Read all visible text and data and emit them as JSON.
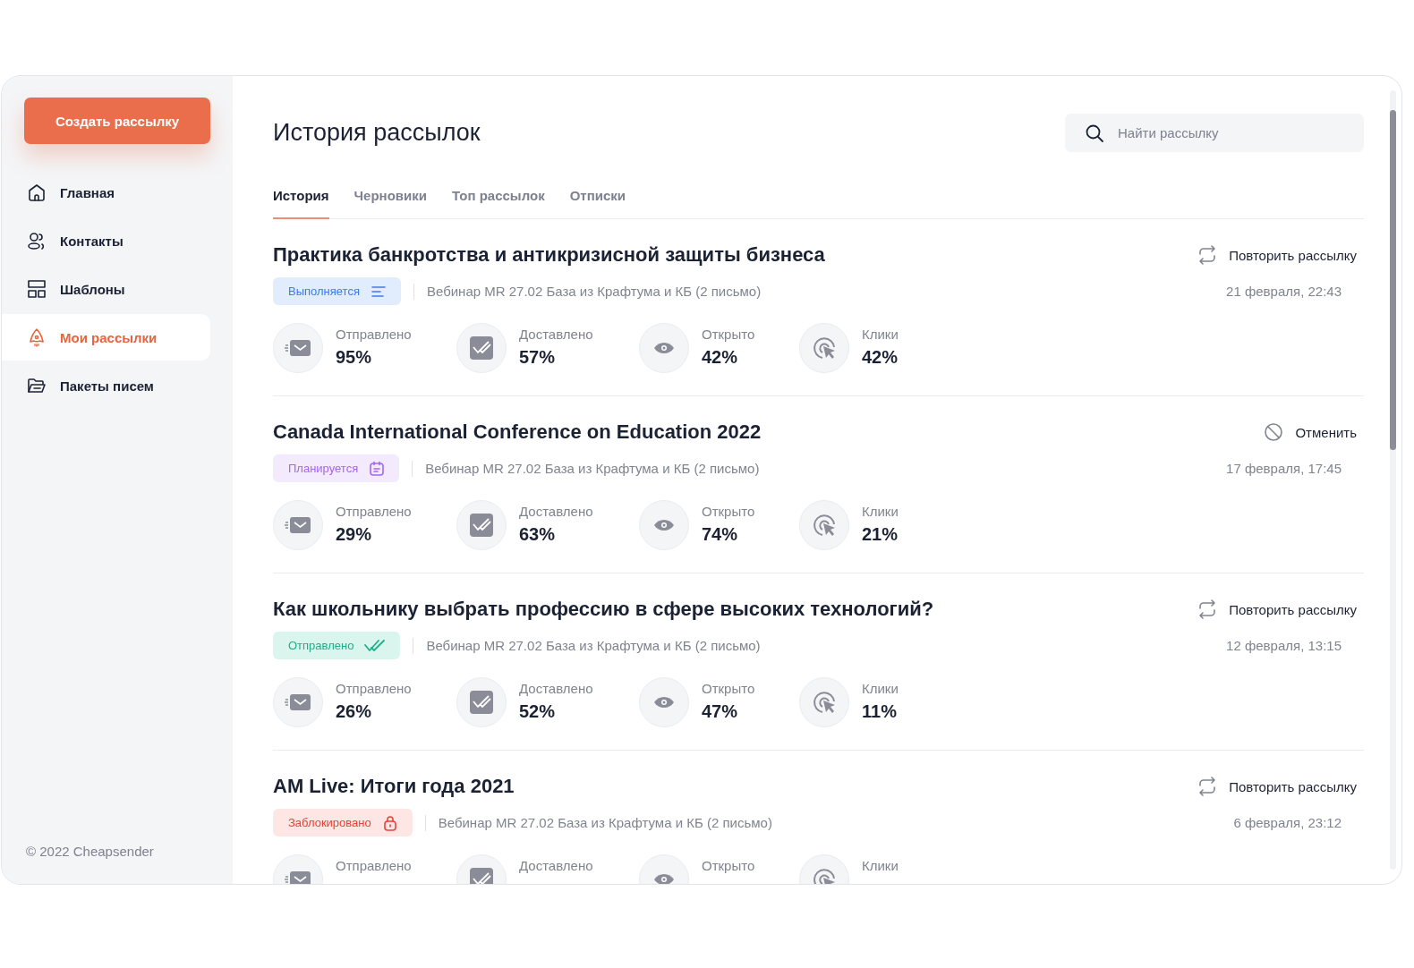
{
  "sidebar": {
    "create_button": "Создать рассылку",
    "items": [
      {
        "label": "Главная",
        "kind": "home",
        "selected": false
      },
      {
        "label": "Контакты",
        "kind": "users",
        "selected": false
      },
      {
        "label": "Шаблоны",
        "kind": "layout",
        "selected": false
      },
      {
        "label": "Мои рассылки",
        "kind": "rocket",
        "selected": true
      },
      {
        "label": "Пакеты писем",
        "kind": "folder",
        "selected": false
      }
    ],
    "footer": "© 2022 Cheapsender"
  },
  "header": {
    "title": "История рассылок",
    "search": {
      "placeholder": "Найти рассылку"
    }
  },
  "tabs": [
    {
      "label": "История",
      "selected": true
    },
    {
      "label": "Черновики",
      "selected": false
    },
    {
      "label": "Топ рассылок",
      "selected": false
    },
    {
      "label": "Отписки",
      "selected": false
    }
  ],
  "campaigns": [
    {
      "title": "Практика банкротства и антикризисной защиты бизнеса",
      "status": {
        "kind": "running",
        "label": "Выполняется"
      },
      "source": "Вебинар MR 27.02 База из Крафтума и КБ (2 письмо)",
      "action": {
        "kind": "repeat",
        "label": "Повторить рассылку"
      },
      "date": "21 февраля, 22:43",
      "stats": [
        {
          "kind": "sent",
          "label": "Отправлено",
          "value": "95%"
        },
        {
          "kind": "delivered",
          "label": "Доставлено",
          "value": "57%"
        },
        {
          "kind": "opened",
          "label": "Открыто",
          "value": "42%"
        },
        {
          "kind": "clicks",
          "label": "Клики",
          "value": "42%"
        }
      ]
    },
    {
      "title": "Canada International Conference on Education 2022",
      "status": {
        "kind": "planned",
        "label": "Планируется"
      },
      "source": "Вебинар MR 27.02 База из Крафтума и КБ (2 письмо)",
      "action": {
        "kind": "cancel",
        "label": "Отменить"
      },
      "date": "17 февраля, 17:45",
      "stats": [
        {
          "kind": "sent",
          "label": "Отправлено",
          "value": "29%"
        },
        {
          "kind": "delivered",
          "label": "Доставлено",
          "value": "63%"
        },
        {
          "kind": "opened",
          "label": "Открыто",
          "value": "74%"
        },
        {
          "kind": "clicks",
          "label": "Клики",
          "value": "21%"
        }
      ]
    },
    {
      "title": "Как школьнику выбрать профессию в сфере высоких технологий?",
      "status": {
        "kind": "sent",
        "label": "Отправлено"
      },
      "source": "Вебинар MR 27.02 База из Крафтума и КБ (2 письмо)",
      "action": {
        "kind": "repeat",
        "label": "Повторить рассылку"
      },
      "date": "12 февраля, 13:15",
      "stats": [
        {
          "kind": "sent",
          "label": "Отправлено",
          "value": "26%"
        },
        {
          "kind": "delivered",
          "label": "Доставлено",
          "value": "52%"
        },
        {
          "kind": "opened",
          "label": "Открыто",
          "value": "47%"
        },
        {
          "kind": "clicks",
          "label": "Клики",
          "value": "11%"
        }
      ]
    },
    {
      "title": "AM Live: Итоги года 2021",
      "status": {
        "kind": "blocked",
        "label": "Заблокировано"
      },
      "source": "Вебинар MR 27.02 База из Крафтума и КБ (2 письмо)",
      "action": {
        "kind": "repeat",
        "label": "Повторить рассылку"
      },
      "date": "6 февраля, 23:12",
      "stats": [
        {
          "kind": "sent",
          "label": "Отправлено"
        },
        {
          "kind": "delivered",
          "label": "Доставлено"
        },
        {
          "kind": "opened",
          "label": "Открыто"
        },
        {
          "kind": "clicks",
          "label": "Клики"
        }
      ]
    }
  ]
}
